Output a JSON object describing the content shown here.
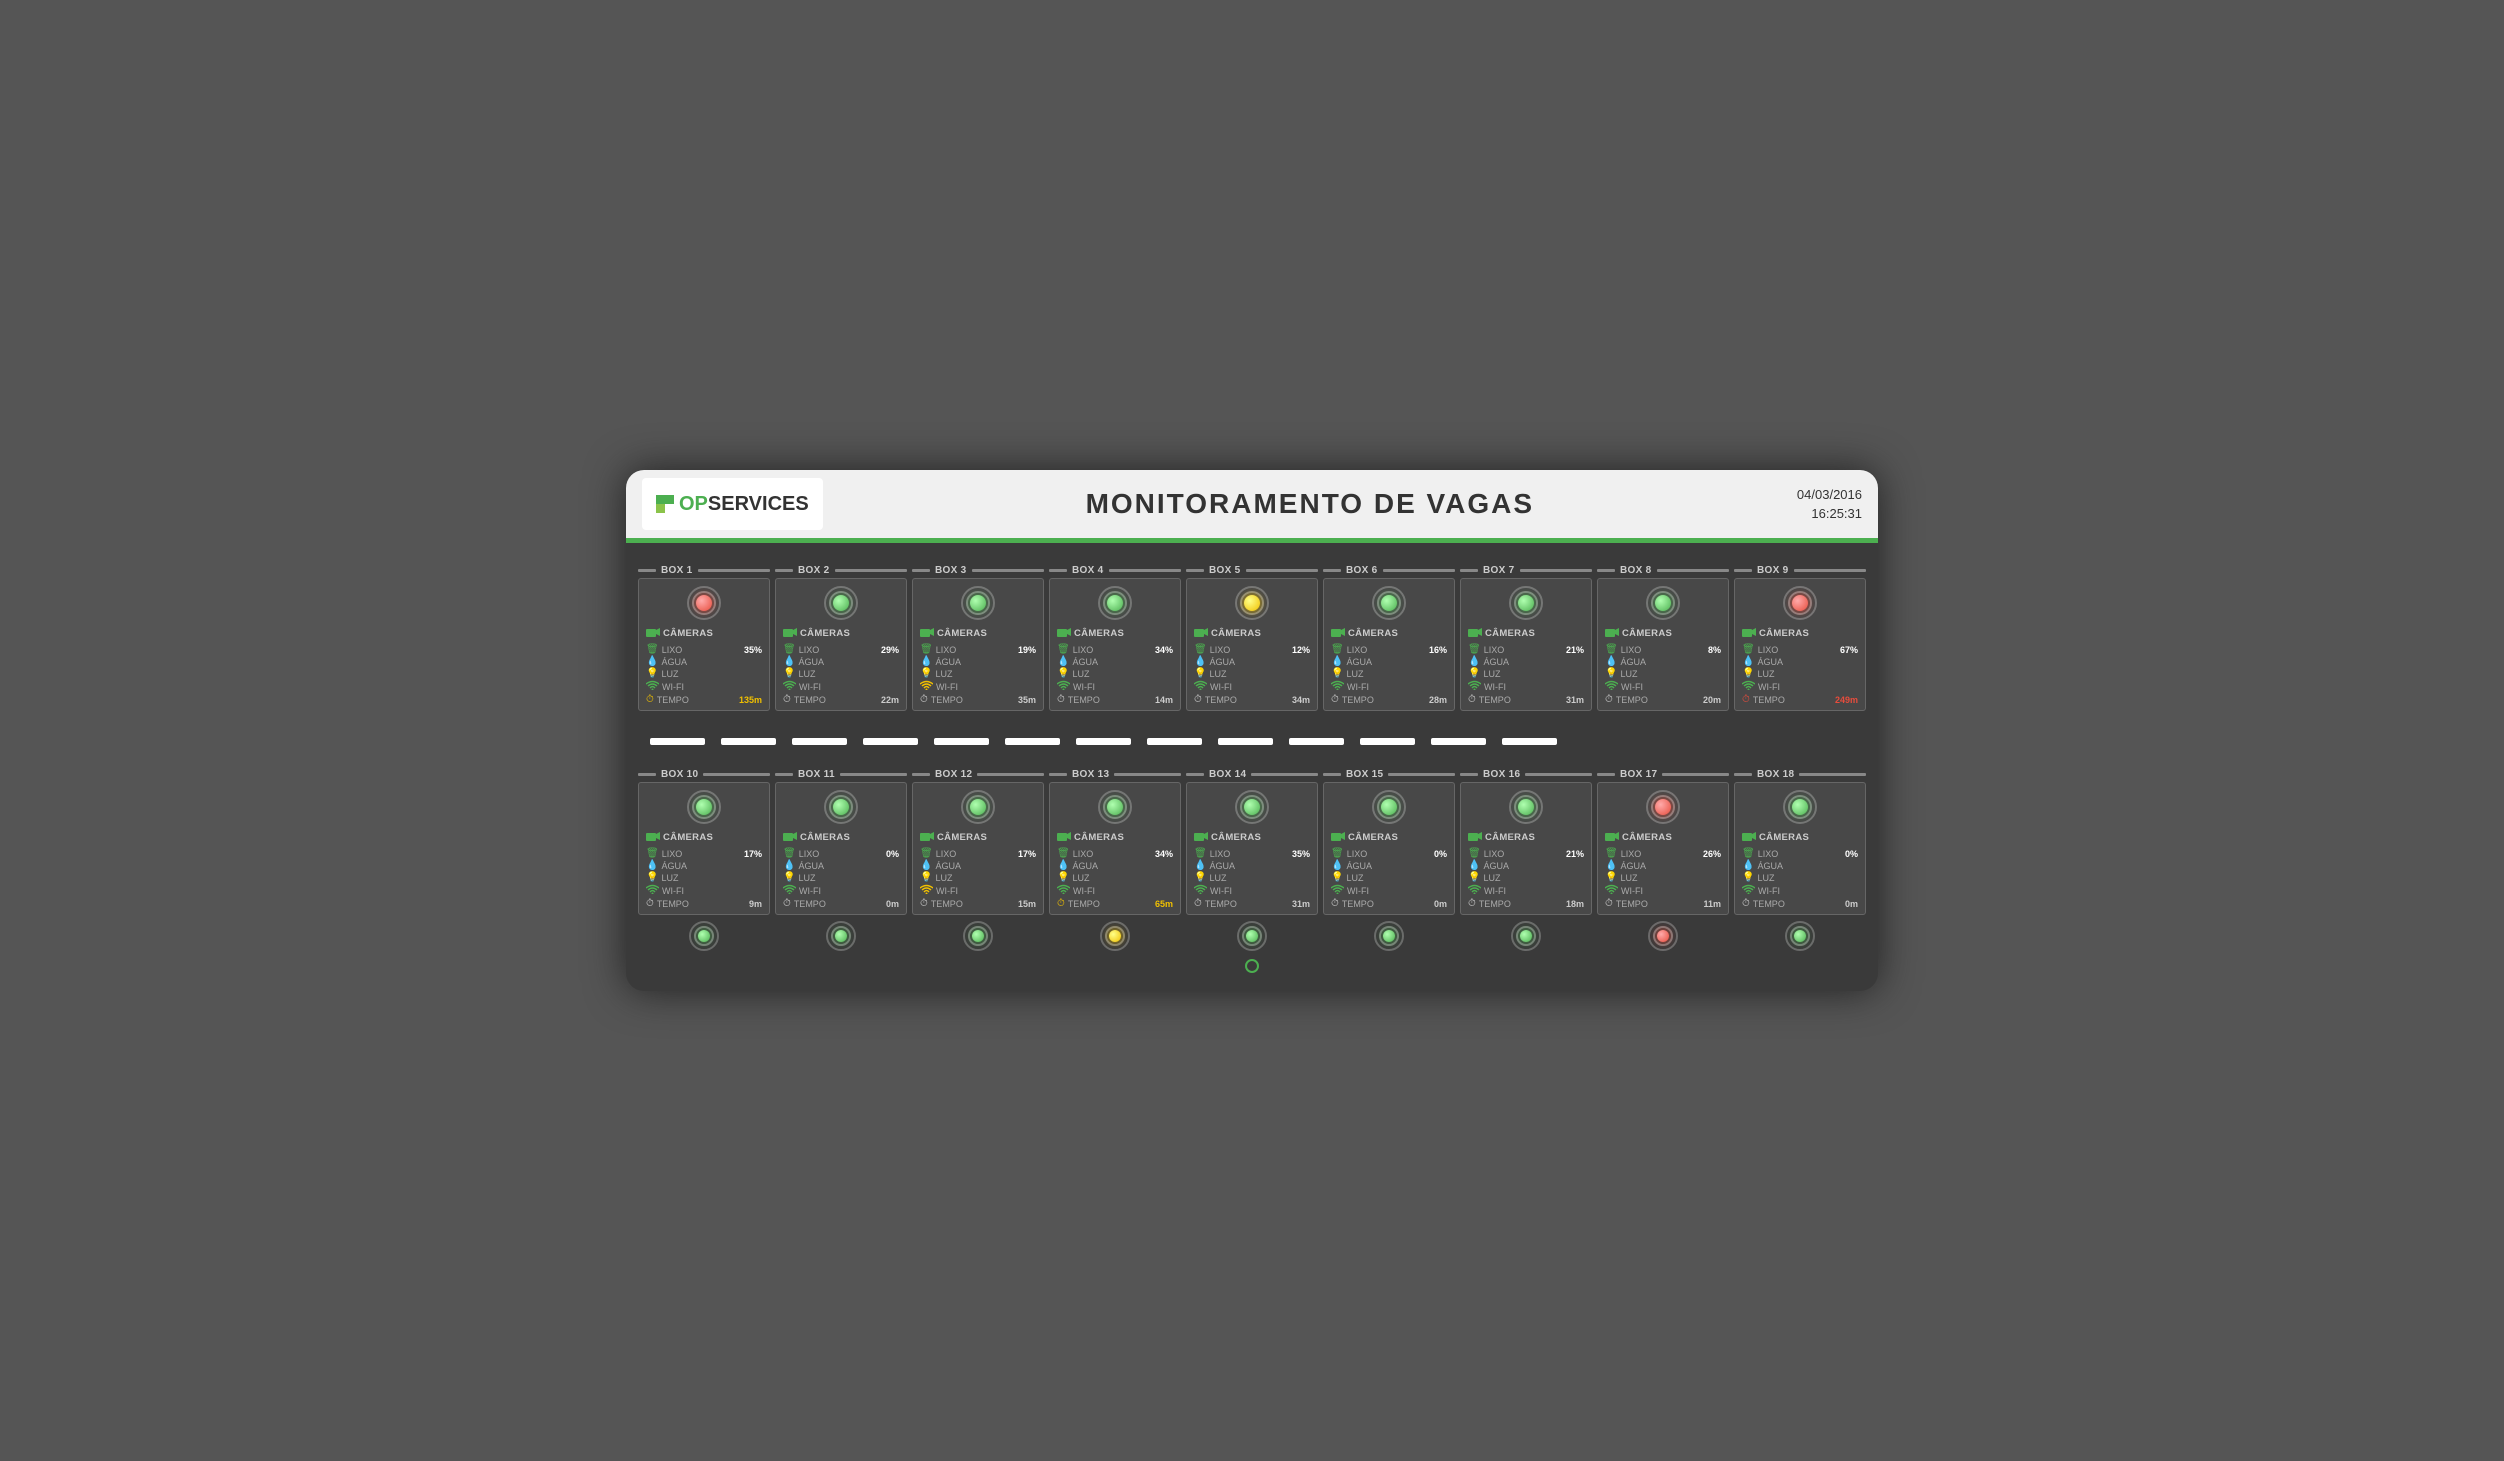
{
  "header": {
    "title": "MONITORAMENTO DE VAGAS",
    "logo_op": "OP",
    "logo_services": "SERVICES",
    "date": "04/03/2016",
    "time": "16:25:31"
  },
  "row1": {
    "boxes": [
      {
        "name": "BOX 1",
        "signal": "red",
        "cameras": "CÂMERAS",
        "lixo": "35%",
        "lixo_color": "white",
        "tempo": "135m",
        "tempo_color": "yellow"
      },
      {
        "name": "BOX 2",
        "signal": "green",
        "cameras": "CÂMERAS",
        "lixo": "29%",
        "lixo_color": "white",
        "tempo": "22m",
        "tempo_color": "white"
      },
      {
        "name": "BOX 3",
        "signal": "green",
        "cameras": "CÂMERAS",
        "lixo": "19%",
        "lixo_color": "white",
        "tempo": "35m",
        "tempo_color": "white"
      },
      {
        "name": "BOX 4",
        "signal": "green",
        "cameras": "CÂMERAS",
        "lixo": "34%",
        "lixo_color": "white",
        "tempo": "14m",
        "tempo_color": "white"
      },
      {
        "name": "BOX 5",
        "signal": "yellow",
        "cameras": "CÂMERAS",
        "lixo": "12%",
        "lixo_color": "white",
        "tempo": "34m",
        "tempo_color": "white"
      },
      {
        "name": "BOX 6",
        "signal": "green",
        "cameras": "CÂMERAS",
        "lixo": "16%",
        "lixo_color": "white",
        "tempo": "28m",
        "tempo_color": "white"
      },
      {
        "name": "BOX 7",
        "signal": "green",
        "cameras": "CÂMERAS",
        "lixo": "21%",
        "lixo_color": "white",
        "tempo": "31m",
        "tempo_color": "white"
      },
      {
        "name": "BOX 8",
        "signal": "green",
        "cameras": "CÂMERAS",
        "lixo": "8%",
        "lixo_color": "white",
        "tempo": "20m",
        "tempo_color": "white"
      },
      {
        "name": "BOX 9",
        "signal": "red",
        "cameras": "CÂMERAS",
        "lixo": "67%",
        "lixo_color": "white",
        "tempo": "249m",
        "tempo_color": "red"
      }
    ]
  },
  "row2": {
    "boxes": [
      {
        "name": "BOX 10",
        "signal": "green",
        "cameras": "CÂMERAS",
        "lixo": "17%",
        "lixo_color": "white",
        "tempo": "9m",
        "tempo_color": "white",
        "bottom_signal": "green"
      },
      {
        "name": "BOX 11",
        "signal": "green",
        "cameras": "CÂMERAS",
        "lixo": "0%",
        "lixo_color": "white",
        "tempo": "0m",
        "tempo_color": "white",
        "bottom_signal": "green"
      },
      {
        "name": "BOX 12",
        "signal": "green",
        "cameras": "CÂMERAS",
        "lixo": "17%",
        "lixo_color": "white",
        "tempo": "15m",
        "tempo_color": "white",
        "bottom_signal": "green"
      },
      {
        "name": "BOX 13",
        "signal": "green",
        "cameras": "CÂMERAS",
        "lixo": "34%",
        "lixo_color": "white",
        "tempo": "65m",
        "tempo_color": "yellow",
        "bottom_signal": "yellow"
      },
      {
        "name": "BOX 14",
        "signal": "green",
        "cameras": "CÂMERAS",
        "lixo": "35%",
        "lixo_color": "white",
        "tempo": "31m",
        "tempo_color": "white",
        "bottom_signal": "green"
      },
      {
        "name": "BOX 15",
        "signal": "green",
        "cameras": "CÂMERAS",
        "lixo": "0%",
        "lixo_color": "white",
        "tempo": "0m",
        "tempo_color": "white",
        "bottom_signal": "green"
      },
      {
        "name": "BOX 16",
        "signal": "green",
        "cameras": "CÂMERAS",
        "lixo": "21%",
        "lixo_color": "white",
        "tempo": "18m",
        "tempo_color": "white",
        "bottom_signal": "green"
      },
      {
        "name": "BOX 17",
        "signal": "red",
        "cameras": "CÂMERAS",
        "lixo": "26%",
        "lixo_color": "white",
        "tempo": "11m",
        "tempo_color": "white",
        "bottom_signal": "red"
      },
      {
        "name": "BOX 18",
        "signal": "green",
        "cameras": "CÂMERAS",
        "lixo": "0%",
        "lixo_color": "white",
        "tempo": "0m",
        "tempo_color": "white",
        "bottom_signal": "green"
      }
    ]
  },
  "labels": {
    "cameras": "CÂMERAS",
    "lixo": "LIXO",
    "agua": "ÁGUA",
    "luz": "LUZ",
    "wifi": "WI-FI",
    "tempo": "TEMPO"
  }
}
